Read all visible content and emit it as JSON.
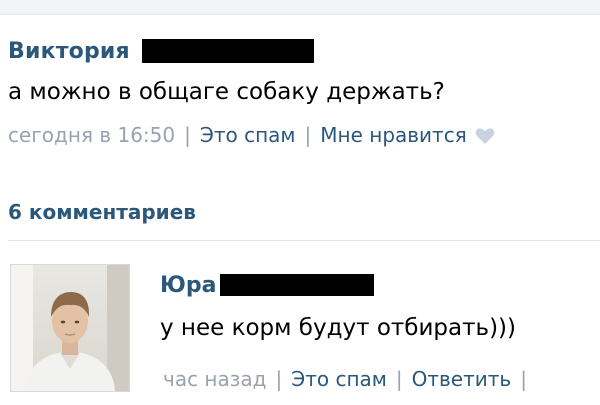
{
  "post": {
    "author": "Виктория",
    "text": "а можно в общаге собаку держать?",
    "time": "сегодня в 16:50",
    "separator": "|",
    "spam_label": "Это спам",
    "like_label": "Мне нравится",
    "like_icon": "heart-icon"
  },
  "comments": {
    "header": "6 комментариев",
    "items": [
      {
        "author": "Юра",
        "text": "у нее корм будут отбирать)))",
        "time": "час назад",
        "separator": "|",
        "spam_label": "Это спам",
        "reply_label": "Ответить",
        "avatar_icon": "user-photo-avatar"
      }
    ]
  },
  "colors": {
    "link": "#2b587a",
    "meta": "#9aa3ad",
    "text": "#000000",
    "redaction": "#000000"
  }
}
